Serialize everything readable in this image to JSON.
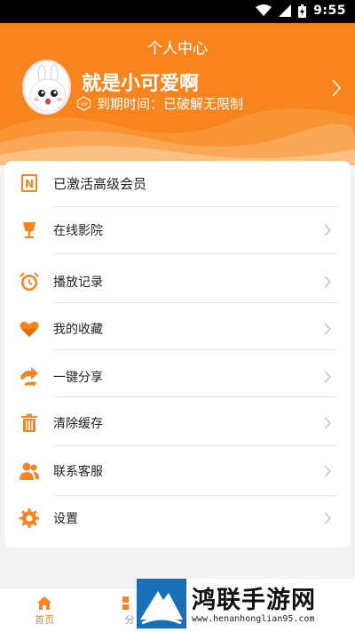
{
  "status_bar": {
    "time": "9:55",
    "icons": [
      "wifi-icon",
      "signal-icon",
      "battery-icon"
    ]
  },
  "header": {
    "title": "个人中心",
    "username": "就是小可爱啊",
    "vip_badge": "VIP",
    "expiry_text": "到期时间：已破解无限制"
  },
  "menu": {
    "items": [
      {
        "label": "已激活高级会员",
        "icon": "member-n-icon"
      },
      {
        "label": "在线影院",
        "icon": "trophy-cup-icon"
      },
      {
        "label": "播放记录",
        "icon": "alarm-clock-icon"
      },
      {
        "label": "我的收藏",
        "icon": "heart-icon"
      },
      {
        "label": "一键分享",
        "icon": "share-icon"
      },
      {
        "label": "清除缓存",
        "icon": "trash-icon"
      },
      {
        "label": "联系客服",
        "icon": "users-icon"
      },
      {
        "label": "设置",
        "icon": "gear-icon"
      }
    ]
  },
  "tabbar": {
    "tabs": [
      {
        "label": "首页",
        "icon": "home-icon",
        "active": true
      },
      {
        "label": "分",
        "icon": "category-icon",
        "active": false
      }
    ]
  },
  "watermark": {
    "title": "鸿联手游网",
    "url": "www.henanhonglian95.com"
  },
  "colors": {
    "accent": "#f7841d",
    "card_bg": "#ffffff",
    "page_bg": "#f2f2f2"
  }
}
